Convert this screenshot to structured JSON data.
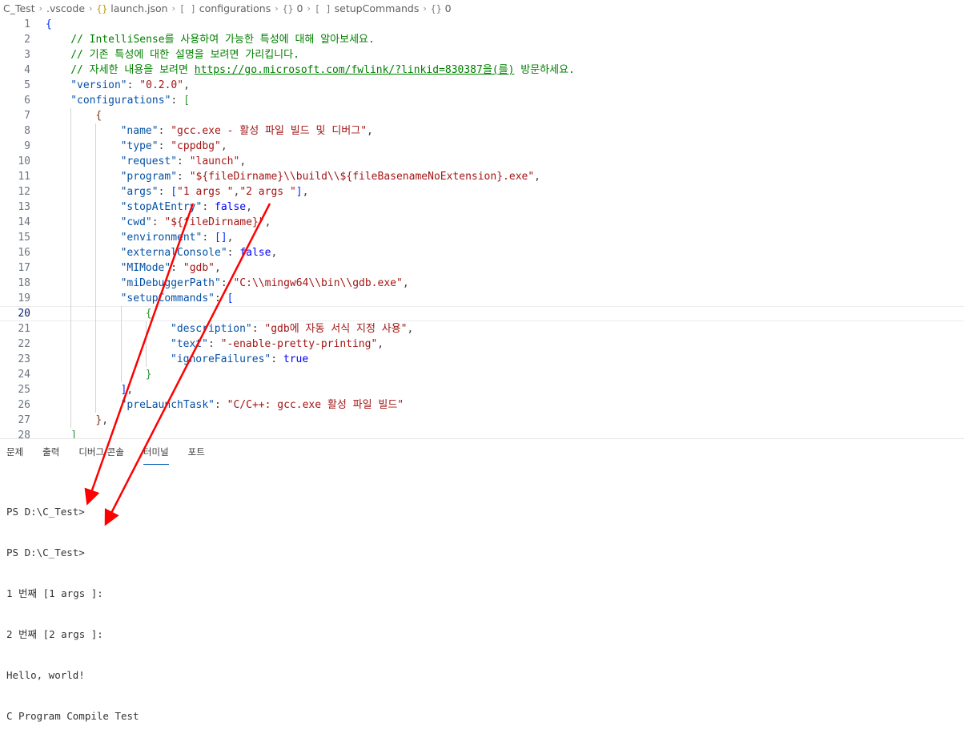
{
  "breadcrumb": [
    {
      "icon": "",
      "label": "C_Test"
    },
    {
      "icon": "",
      "label": ".vscode"
    },
    {
      "icon": "{}",
      "label": "launch.json"
    },
    {
      "icon": "[ ]",
      "label": "configurations"
    },
    {
      "icon": "{}",
      "label": "0"
    },
    {
      "icon": "[ ]",
      "label": "setupCommands"
    },
    {
      "icon": "{}",
      "label": "0"
    }
  ],
  "editor": {
    "current_line": 20,
    "lines": [
      {
        "n": "1",
        "indent": 0,
        "tokens": [
          {
            "t": "{",
            "c": "br1"
          }
        ]
      },
      {
        "n": "2",
        "indent": 1,
        "tokens": [
          {
            "t": "// IntelliSense를 사용하여 가능한 특성에 대해 알아보세요.",
            "c": "com"
          }
        ]
      },
      {
        "n": "3",
        "indent": 1,
        "tokens": [
          {
            "t": "// 기존 특성에 대한 설명을 보려면 가리킵니다.",
            "c": "com"
          }
        ]
      },
      {
        "n": "4",
        "indent": 1,
        "tokens": [
          {
            "t": "// 자세한 내용을 보려면 ",
            "c": "com"
          },
          {
            "t": "https://go.microsoft.com/fwlink/?linkid=830387을(를)",
            "c": "link"
          },
          {
            "t": " 방문하세요.",
            "c": "com"
          }
        ]
      },
      {
        "n": "5",
        "indent": 1,
        "tokens": [
          {
            "t": "\"version\"",
            "c": "key"
          },
          {
            "t": ": ",
            "c": "pun"
          },
          {
            "t": "\"0.2.0\"",
            "c": "str"
          },
          {
            "t": ",",
            "c": "pun"
          }
        ]
      },
      {
        "n": "6",
        "indent": 1,
        "tokens": [
          {
            "t": "\"configurations\"",
            "c": "key"
          },
          {
            "t": ": ",
            "c": "pun"
          },
          {
            "t": "[",
            "c": "br2"
          }
        ]
      },
      {
        "n": "7",
        "indent": 2,
        "tokens": [
          {
            "t": "{",
            "c": "br3"
          }
        ]
      },
      {
        "n": "8",
        "indent": 3,
        "tokens": [
          {
            "t": "\"name\"",
            "c": "key"
          },
          {
            "t": ": ",
            "c": "pun"
          },
          {
            "t": "\"gcc.exe - 활성 파일 빌드 및 디버그\"",
            "c": "str"
          },
          {
            "t": ",",
            "c": "pun"
          }
        ]
      },
      {
        "n": "9",
        "indent": 3,
        "tokens": [
          {
            "t": "\"type\"",
            "c": "key"
          },
          {
            "t": ": ",
            "c": "pun"
          },
          {
            "t": "\"cppdbg\"",
            "c": "str"
          },
          {
            "t": ",",
            "c": "pun"
          }
        ]
      },
      {
        "n": "10",
        "indent": 3,
        "tokens": [
          {
            "t": "\"request\"",
            "c": "key"
          },
          {
            "t": ": ",
            "c": "pun"
          },
          {
            "t": "\"launch\"",
            "c": "str"
          },
          {
            "t": ",",
            "c": "pun"
          }
        ]
      },
      {
        "n": "11",
        "indent": 3,
        "tokens": [
          {
            "t": "\"program\"",
            "c": "key"
          },
          {
            "t": ": ",
            "c": "pun"
          },
          {
            "t": "\"${fileDirname}\\\\build\\\\${fileBasenameNoExtension}.exe\"",
            "c": "str"
          },
          {
            "t": ",",
            "c": "pun"
          }
        ]
      },
      {
        "n": "12",
        "indent": 3,
        "tokens": [
          {
            "t": "\"args\"",
            "c": "key"
          },
          {
            "t": ": ",
            "c": "pun"
          },
          {
            "t": "[",
            "c": "br1"
          },
          {
            "t": "\"1 args \"",
            "c": "str"
          },
          {
            "t": ",",
            "c": "pun"
          },
          {
            "t": "\"2 args \"",
            "c": "str"
          },
          {
            "t": "]",
            "c": "br1"
          },
          {
            "t": ",",
            "c": "pun"
          }
        ]
      },
      {
        "n": "13",
        "indent": 3,
        "tokens": [
          {
            "t": "\"stopAtEntry\"",
            "c": "key"
          },
          {
            "t": ": ",
            "c": "pun"
          },
          {
            "t": "false",
            "c": "kw"
          },
          {
            "t": ",",
            "c": "pun"
          }
        ]
      },
      {
        "n": "14",
        "indent": 3,
        "tokens": [
          {
            "t": "\"cwd\"",
            "c": "key"
          },
          {
            "t": ": ",
            "c": "pun"
          },
          {
            "t": "\"${fileDirname}\"",
            "c": "str"
          },
          {
            "t": ",",
            "c": "pun"
          }
        ]
      },
      {
        "n": "15",
        "indent": 3,
        "tokens": [
          {
            "t": "\"environment\"",
            "c": "key"
          },
          {
            "t": ": ",
            "c": "pun"
          },
          {
            "t": "[]",
            "c": "br1"
          },
          {
            "t": ",",
            "c": "pun"
          }
        ]
      },
      {
        "n": "16",
        "indent": 3,
        "tokens": [
          {
            "t": "\"externalConsole\"",
            "c": "key"
          },
          {
            "t": ": ",
            "c": "pun"
          },
          {
            "t": "false",
            "c": "kw"
          },
          {
            "t": ",",
            "c": "pun"
          }
        ]
      },
      {
        "n": "17",
        "indent": 3,
        "tokens": [
          {
            "t": "\"MIMode\"",
            "c": "key"
          },
          {
            "t": ": ",
            "c": "pun"
          },
          {
            "t": "\"gdb\"",
            "c": "str"
          },
          {
            "t": ",",
            "c": "pun"
          }
        ]
      },
      {
        "n": "18",
        "indent": 3,
        "tokens": [
          {
            "t": "\"miDebuggerPath\"",
            "c": "key"
          },
          {
            "t": ": ",
            "c": "pun"
          },
          {
            "t": "\"C:\\\\mingw64\\\\bin\\\\gdb.exe\"",
            "c": "str"
          },
          {
            "t": ",",
            "c": "pun"
          }
        ]
      },
      {
        "n": "19",
        "indent": 3,
        "tokens": [
          {
            "t": "\"setupCommands\"",
            "c": "key"
          },
          {
            "t": ": ",
            "c": "pun"
          },
          {
            "t": "[",
            "c": "br1"
          }
        ]
      },
      {
        "n": "20",
        "indent": 4,
        "tokens": [
          {
            "t": "{",
            "c": "br2"
          }
        ]
      },
      {
        "n": "21",
        "indent": 5,
        "tokens": [
          {
            "t": "\"description\"",
            "c": "key"
          },
          {
            "t": ": ",
            "c": "pun"
          },
          {
            "t": "\"gdb에 자동 서식 지정 사용\"",
            "c": "str"
          },
          {
            "t": ",",
            "c": "pun"
          }
        ]
      },
      {
        "n": "22",
        "indent": 5,
        "tokens": [
          {
            "t": "\"text\"",
            "c": "key"
          },
          {
            "t": ": ",
            "c": "pun"
          },
          {
            "t": "\"-enable-pretty-printing\"",
            "c": "str"
          },
          {
            "t": ",",
            "c": "pun"
          }
        ]
      },
      {
        "n": "23",
        "indent": 5,
        "tokens": [
          {
            "t": "\"ignoreFailures\"",
            "c": "key"
          },
          {
            "t": ": ",
            "c": "pun"
          },
          {
            "t": "true",
            "c": "kw"
          }
        ]
      },
      {
        "n": "24",
        "indent": 4,
        "tokens": [
          {
            "t": "}",
            "c": "br2"
          }
        ]
      },
      {
        "n": "25",
        "indent": 3,
        "tokens": [
          {
            "t": "]",
            "c": "br1"
          },
          {
            "t": ",",
            "c": "pun"
          }
        ]
      },
      {
        "n": "26",
        "indent": 3,
        "tokens": [
          {
            "t": "\"preLaunchTask\"",
            "c": "key"
          },
          {
            "t": ": ",
            "c": "pun"
          },
          {
            "t": "\"C/C++: gcc.exe 활성 파일 빌드\"",
            "c": "str"
          }
        ]
      },
      {
        "n": "27",
        "indent": 2,
        "tokens": [
          {
            "t": "}",
            "c": "br3"
          },
          {
            "t": ",",
            "c": "pun"
          }
        ]
      },
      {
        "n": "28",
        "indent": 1,
        "tokens": [
          {
            "t": "]",
            "c": "br2"
          }
        ]
      }
    ]
  },
  "panel": {
    "tabs": [
      {
        "label": "문제",
        "active": false
      },
      {
        "label": "출력",
        "active": false
      },
      {
        "label": "디버그 콘솔",
        "active": false
      },
      {
        "label": "터미널",
        "active": true
      },
      {
        "label": "포트",
        "active": false
      }
    ],
    "terminal_lines": [
      "PS D:\\C_Test>",
      "PS D:\\C_Test>",
      "1 번째 [1 args ]:",
      "2 번째 [2 args ]:",
      "Hello, world!",
      "C Program Compile Test"
    ]
  },
  "annotation_color": "#ff0000"
}
